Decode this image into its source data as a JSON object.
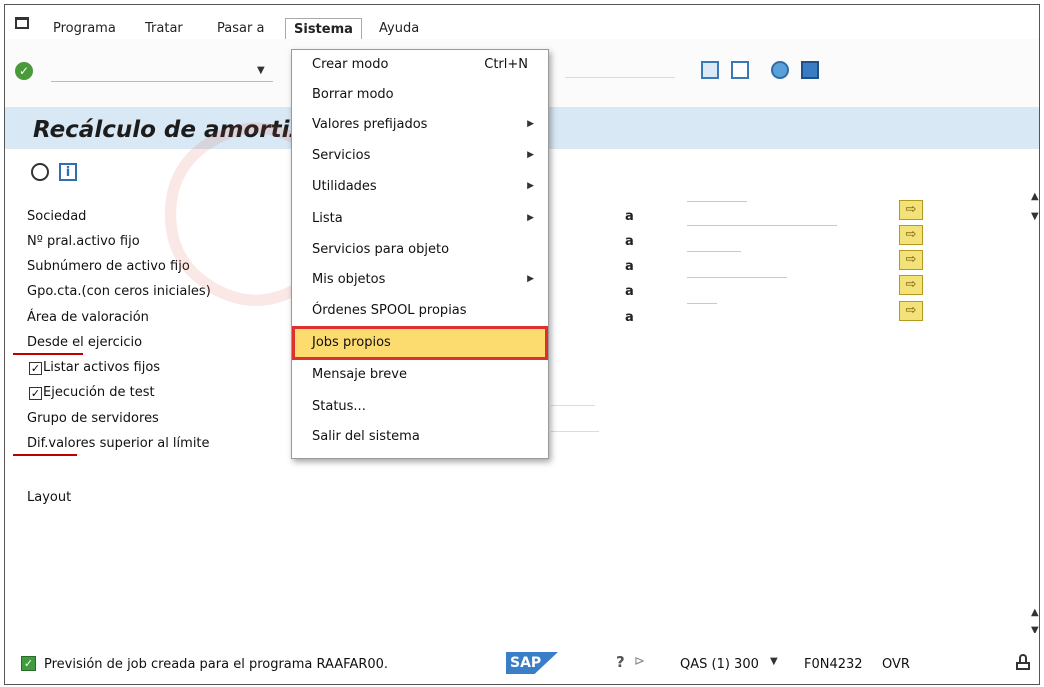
{
  "menubar": {
    "items": [
      "Programa",
      "Tratar",
      "Pasar a",
      "Sistema",
      "Ayuda"
    ],
    "active": "Sistema"
  },
  "title": "Recálculo de amortiza",
  "form": {
    "labels": [
      "Sociedad",
      "Nº pral.activo fijo",
      "Subnúmero de activo fijo",
      "Gpo.cta.(con ceros iniciales)",
      "Área de valoración",
      "Desde el ejercicio",
      "Listar activos fijos",
      "Ejecución de test",
      "Grupo de servidores",
      "Dif.valores superior al límite"
    ],
    "checkboxes": [
      {
        "label": "Listar activos fijos",
        "checked": true
      },
      {
        "label": "Ejecución de test",
        "checked": true
      }
    ],
    "range_to": "a",
    "layout_label": "Layout"
  },
  "menu": {
    "items": [
      {
        "label": "Crear modo",
        "shortcut": "Ctrl+N",
        "submenu": false
      },
      {
        "label": "Borrar modo",
        "shortcut": "",
        "submenu": false
      },
      {
        "label": "Valores prefijados",
        "shortcut": "",
        "submenu": true
      },
      {
        "label": "Servicios",
        "shortcut": "",
        "submenu": true
      },
      {
        "label": "Utilidades",
        "shortcut": "",
        "submenu": true
      },
      {
        "label": "Lista",
        "shortcut": "",
        "submenu": true
      },
      {
        "label": "Servicios para objeto",
        "shortcut": "",
        "submenu": false
      },
      {
        "label": "Mis objetos",
        "shortcut": "",
        "submenu": true
      },
      {
        "label": "Órdenes SPOOL propias",
        "shortcut": "",
        "submenu": false
      },
      {
        "label": "Jobs propios",
        "shortcut": "",
        "submenu": false,
        "highlighted": true
      },
      {
        "label": "Mensaje breve",
        "shortcut": "",
        "submenu": false
      },
      {
        "label": "Status...",
        "shortcut": "",
        "submenu": false
      },
      {
        "label": "Salir del sistema",
        "shortcut": "",
        "submenu": false
      }
    ]
  },
  "status": {
    "message": "Previsión de job creada para el programa RAAFAR00.",
    "sap_logo": "SAP",
    "system": "QAS (1) 300",
    "host": "F0N4232",
    "mode": "OVR"
  },
  "icons": {
    "toolbar": [
      "check-icon",
      "layout-icon",
      "window-icon",
      "help-icon",
      "monitor-icon"
    ],
    "app": [
      "execute-clock-icon",
      "info-icon"
    ],
    "select": "multiple-selection-icon"
  },
  "colors": {
    "title_bar": "#d8e8f4",
    "menu_highlight": "#fcdc6f",
    "highlight_border": "#e0302e",
    "select_button": "#f3e27a",
    "ok_green": "#4a9a3a"
  }
}
